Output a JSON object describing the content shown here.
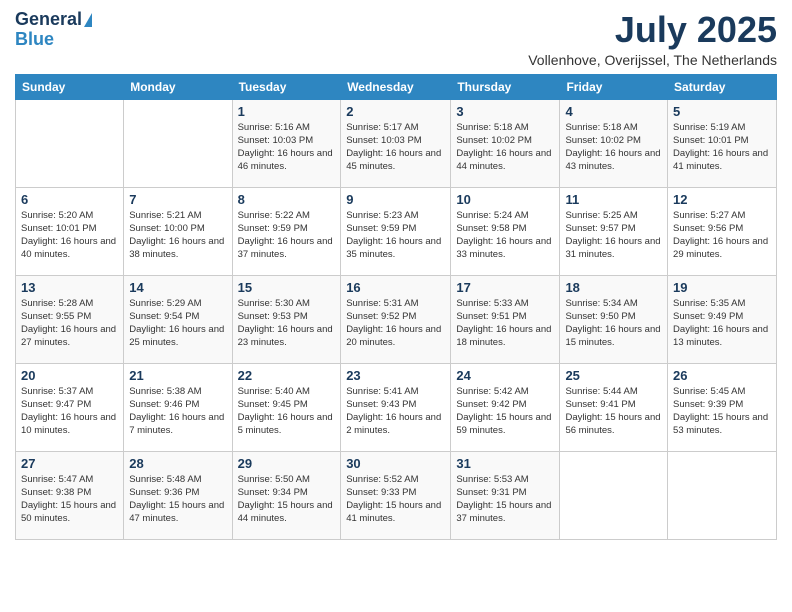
{
  "logo": {
    "line1": "General",
    "line2": "Blue"
  },
  "title": "July 2025",
  "location": "Vollenhove, Overijssel, The Netherlands",
  "weekdays": [
    "Sunday",
    "Monday",
    "Tuesday",
    "Wednesday",
    "Thursday",
    "Friday",
    "Saturday"
  ],
  "weeks": [
    [
      {
        "day": null
      },
      {
        "day": null
      },
      {
        "day": "1",
        "sunrise": "Sunrise: 5:16 AM",
        "sunset": "Sunset: 10:03 PM",
        "daylight": "Daylight: 16 hours and 46 minutes."
      },
      {
        "day": "2",
        "sunrise": "Sunrise: 5:17 AM",
        "sunset": "Sunset: 10:03 PM",
        "daylight": "Daylight: 16 hours and 45 minutes."
      },
      {
        "day": "3",
        "sunrise": "Sunrise: 5:18 AM",
        "sunset": "Sunset: 10:02 PM",
        "daylight": "Daylight: 16 hours and 44 minutes."
      },
      {
        "day": "4",
        "sunrise": "Sunrise: 5:18 AM",
        "sunset": "Sunset: 10:02 PM",
        "daylight": "Daylight: 16 hours and 43 minutes."
      },
      {
        "day": "5",
        "sunrise": "Sunrise: 5:19 AM",
        "sunset": "Sunset: 10:01 PM",
        "daylight": "Daylight: 16 hours and 41 minutes."
      }
    ],
    [
      {
        "day": "6",
        "sunrise": "Sunrise: 5:20 AM",
        "sunset": "Sunset: 10:01 PM",
        "daylight": "Daylight: 16 hours and 40 minutes."
      },
      {
        "day": "7",
        "sunrise": "Sunrise: 5:21 AM",
        "sunset": "Sunset: 10:00 PM",
        "daylight": "Daylight: 16 hours and 38 minutes."
      },
      {
        "day": "8",
        "sunrise": "Sunrise: 5:22 AM",
        "sunset": "Sunset: 9:59 PM",
        "daylight": "Daylight: 16 hours and 37 minutes."
      },
      {
        "day": "9",
        "sunrise": "Sunrise: 5:23 AM",
        "sunset": "Sunset: 9:59 PM",
        "daylight": "Daylight: 16 hours and 35 minutes."
      },
      {
        "day": "10",
        "sunrise": "Sunrise: 5:24 AM",
        "sunset": "Sunset: 9:58 PM",
        "daylight": "Daylight: 16 hours and 33 minutes."
      },
      {
        "day": "11",
        "sunrise": "Sunrise: 5:25 AM",
        "sunset": "Sunset: 9:57 PM",
        "daylight": "Daylight: 16 hours and 31 minutes."
      },
      {
        "day": "12",
        "sunrise": "Sunrise: 5:27 AM",
        "sunset": "Sunset: 9:56 PM",
        "daylight": "Daylight: 16 hours and 29 minutes."
      }
    ],
    [
      {
        "day": "13",
        "sunrise": "Sunrise: 5:28 AM",
        "sunset": "Sunset: 9:55 PM",
        "daylight": "Daylight: 16 hours and 27 minutes."
      },
      {
        "day": "14",
        "sunrise": "Sunrise: 5:29 AM",
        "sunset": "Sunset: 9:54 PM",
        "daylight": "Daylight: 16 hours and 25 minutes."
      },
      {
        "day": "15",
        "sunrise": "Sunrise: 5:30 AM",
        "sunset": "Sunset: 9:53 PM",
        "daylight": "Daylight: 16 hours and 23 minutes."
      },
      {
        "day": "16",
        "sunrise": "Sunrise: 5:31 AM",
        "sunset": "Sunset: 9:52 PM",
        "daylight": "Daylight: 16 hours and 20 minutes."
      },
      {
        "day": "17",
        "sunrise": "Sunrise: 5:33 AM",
        "sunset": "Sunset: 9:51 PM",
        "daylight": "Daylight: 16 hours and 18 minutes."
      },
      {
        "day": "18",
        "sunrise": "Sunrise: 5:34 AM",
        "sunset": "Sunset: 9:50 PM",
        "daylight": "Daylight: 16 hours and 15 minutes."
      },
      {
        "day": "19",
        "sunrise": "Sunrise: 5:35 AM",
        "sunset": "Sunset: 9:49 PM",
        "daylight": "Daylight: 16 hours and 13 minutes."
      }
    ],
    [
      {
        "day": "20",
        "sunrise": "Sunrise: 5:37 AM",
        "sunset": "Sunset: 9:47 PM",
        "daylight": "Daylight: 16 hours and 10 minutes."
      },
      {
        "day": "21",
        "sunrise": "Sunrise: 5:38 AM",
        "sunset": "Sunset: 9:46 PM",
        "daylight": "Daylight: 16 hours and 7 minutes."
      },
      {
        "day": "22",
        "sunrise": "Sunrise: 5:40 AM",
        "sunset": "Sunset: 9:45 PM",
        "daylight": "Daylight: 16 hours and 5 minutes."
      },
      {
        "day": "23",
        "sunrise": "Sunrise: 5:41 AM",
        "sunset": "Sunset: 9:43 PM",
        "daylight": "Daylight: 16 hours and 2 minutes."
      },
      {
        "day": "24",
        "sunrise": "Sunrise: 5:42 AM",
        "sunset": "Sunset: 9:42 PM",
        "daylight": "Daylight: 15 hours and 59 minutes."
      },
      {
        "day": "25",
        "sunrise": "Sunrise: 5:44 AM",
        "sunset": "Sunset: 9:41 PM",
        "daylight": "Daylight: 15 hours and 56 minutes."
      },
      {
        "day": "26",
        "sunrise": "Sunrise: 5:45 AM",
        "sunset": "Sunset: 9:39 PM",
        "daylight": "Daylight: 15 hours and 53 minutes."
      }
    ],
    [
      {
        "day": "27",
        "sunrise": "Sunrise: 5:47 AM",
        "sunset": "Sunset: 9:38 PM",
        "daylight": "Daylight: 15 hours and 50 minutes."
      },
      {
        "day": "28",
        "sunrise": "Sunrise: 5:48 AM",
        "sunset": "Sunset: 9:36 PM",
        "daylight": "Daylight: 15 hours and 47 minutes."
      },
      {
        "day": "29",
        "sunrise": "Sunrise: 5:50 AM",
        "sunset": "Sunset: 9:34 PM",
        "daylight": "Daylight: 15 hours and 44 minutes."
      },
      {
        "day": "30",
        "sunrise": "Sunrise: 5:52 AM",
        "sunset": "Sunset: 9:33 PM",
        "daylight": "Daylight: 15 hours and 41 minutes."
      },
      {
        "day": "31",
        "sunrise": "Sunrise: 5:53 AM",
        "sunset": "Sunset: 9:31 PM",
        "daylight": "Daylight: 15 hours and 37 minutes."
      },
      {
        "day": null
      },
      {
        "day": null
      }
    ]
  ]
}
